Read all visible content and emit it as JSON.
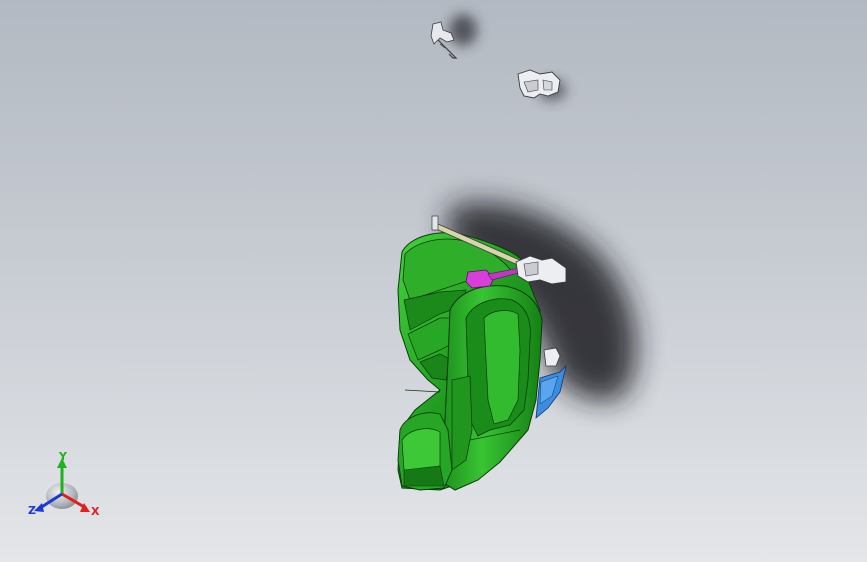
{
  "triad": {
    "labels": {
      "x": "X",
      "y": "Y",
      "z": "Z"
    },
    "colors": {
      "x": "#e0201a",
      "y": "#20b020",
      "z": "#1a3ad0"
    }
  },
  "model": {
    "body_color": "#1f9a1f",
    "body_dark": "#137013",
    "body_light": "#3fcf3a",
    "bracket_color": "#e6e8ec",
    "strap_color": "#d73fd8",
    "blue_part_color": "#3a8de0",
    "rail_color": "#d8d6a6"
  }
}
